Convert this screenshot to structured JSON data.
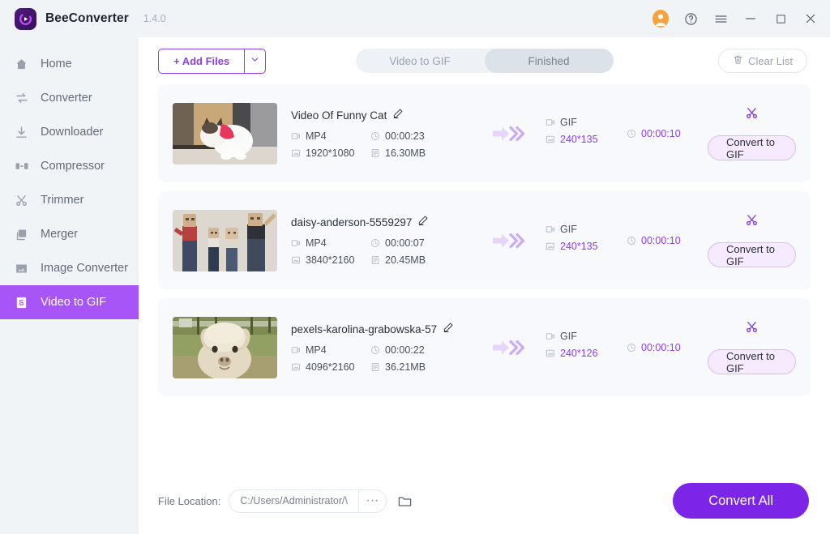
{
  "titlebar": {
    "app_name": "BeeConverter",
    "version": "1.4.0",
    "logo_icon": "bee-play-logo-icon",
    "controls": [
      {
        "name": "account-avatar",
        "icon": "user-avatar-icon",
        "color": "#f7a23b"
      },
      {
        "name": "help-button",
        "icon": "question-circle-icon"
      },
      {
        "name": "menu-button",
        "icon": "hamburger-menu-icon"
      },
      {
        "name": "minimize-button",
        "icon": "minimize-icon"
      },
      {
        "name": "maximize-button",
        "icon": "maximize-square-icon"
      },
      {
        "name": "close-button",
        "icon": "close-x-icon"
      }
    ]
  },
  "sidebar": {
    "active_index": 7,
    "active_color": "#a855f7",
    "items": [
      {
        "label": "Home",
        "icon": "home-icon"
      },
      {
        "label": "Converter",
        "icon": "swap-arrows-icon"
      },
      {
        "label": "Downloader",
        "icon": "download-icon"
      },
      {
        "label": "Compressor",
        "icon": "compress-icon"
      },
      {
        "label": "Trimmer",
        "icon": "scissors-icon"
      },
      {
        "label": "Merger",
        "icon": "layers-icon"
      },
      {
        "label": "Image Converter",
        "icon": "image-icon"
      },
      {
        "label": "Video to GIF",
        "icon": "gif-file-icon"
      }
    ]
  },
  "toolbar": {
    "add_files_label": "+ Add Files",
    "add_files_caret_icon": "chevron-down-icon",
    "tabs": [
      {
        "label": "Video to GIF",
        "selected": false
      },
      {
        "label": "Finished",
        "selected": true
      }
    ],
    "clear_list_label": "Clear List",
    "clear_list_icon": "trash-icon",
    "accent_color": "#8b3ef0"
  },
  "list": {
    "edit_icon": "pencil-edit-icon",
    "arrow_icon": "convert-arrow-icon",
    "trim_icon": "scissors-icon",
    "format_icon": "video-file-icon",
    "resolution_icon": "resolution-icon",
    "duration_icon": "clock-icon",
    "size_icon": "file-size-icon",
    "rows": [
      {
        "thumbnail": "cat-in-red-bow-thumbnail",
        "name": "Video Of Funny Cat",
        "format": "MP4",
        "duration": "00:00:23",
        "resolution": "1920*1080",
        "size": "16.30MB",
        "out_format": "GIF",
        "out_resolution": "240*135",
        "out_duration": "00:00:10",
        "convert_label": "Convert to GIF"
      },
      {
        "thumbnail": "family-paper-bag-masks-thumbnail",
        "name": "daisy-anderson-5559297",
        "format": "MP4",
        "duration": "00:00:07",
        "resolution": "3840*2160",
        "size": "20.45MB",
        "out_format": "GIF",
        "out_resolution": "240*135",
        "out_duration": "00:00:10",
        "convert_label": "Convert to GIF"
      },
      {
        "thumbnail": "alpaca-portrait-thumbnail",
        "name": "pexels-karolina-grabowska-57",
        "format": "MP4",
        "duration": "00:00:22",
        "resolution": "4096*2160",
        "size": "36.21MB",
        "out_format": "GIF",
        "out_resolution": "240*126",
        "out_duration": "00:00:10",
        "convert_label": "Convert to GIF"
      }
    ]
  },
  "bottom": {
    "file_location_label": "File Location:",
    "file_location_value": "C:/Users/Administrator/\\",
    "browse_dots_label": "···",
    "folder_icon": "folder-open-icon",
    "convert_all_label": "Convert All",
    "convert_all_color": "#7c24e8"
  }
}
